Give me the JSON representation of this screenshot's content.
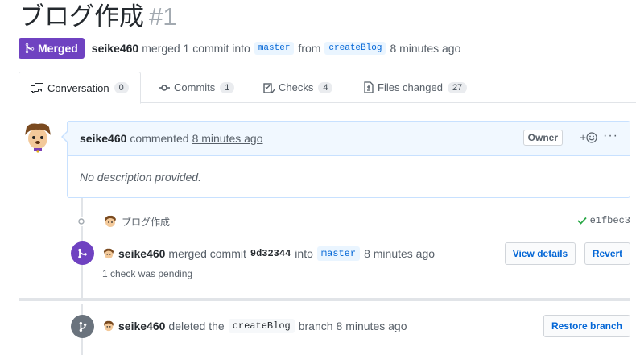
{
  "pr": {
    "title": "ブログ作成",
    "number": "#1",
    "state": "Merged",
    "author": "seike460",
    "merge_text_1": "merged 1 commit into",
    "base_branch": "master",
    "merge_text_2": "from",
    "head_branch": "createBlog",
    "time": "8 minutes ago"
  },
  "tabs": [
    {
      "label": "Conversation",
      "count": "0",
      "icon": "comment-discussion-icon"
    },
    {
      "label": "Commits",
      "count": "1",
      "icon": "git-commit-icon"
    },
    {
      "label": "Checks",
      "count": "4",
      "icon": "checklist-icon"
    },
    {
      "label": "Files changed",
      "count": "27",
      "icon": "file-diff-icon"
    }
  ],
  "comment": {
    "author": "seike460",
    "action": "commented",
    "time": "8 minutes ago",
    "role": "Owner",
    "reaction": "+",
    "more": "···",
    "body": "No description provided."
  },
  "commit": {
    "message": "ブログ作成",
    "sha": "e1fbec3"
  },
  "merge_event": {
    "author": "seike460",
    "text_1": "merged commit",
    "sha": "9d32344",
    "text_2": "into",
    "branch": "master",
    "time": "8 minutes ago",
    "subtext": "1 check was pending",
    "view_details": "View details",
    "revert": "Revert"
  },
  "delete_event": {
    "author": "seike460",
    "text_1": "deleted the",
    "branch": "createBlog",
    "text_2": "branch",
    "time": "8 minutes ago",
    "restore": "Restore branch"
  },
  "colors": {
    "merged": "#6f42c1",
    "link": "#0366d6",
    "success": "#28a745"
  }
}
